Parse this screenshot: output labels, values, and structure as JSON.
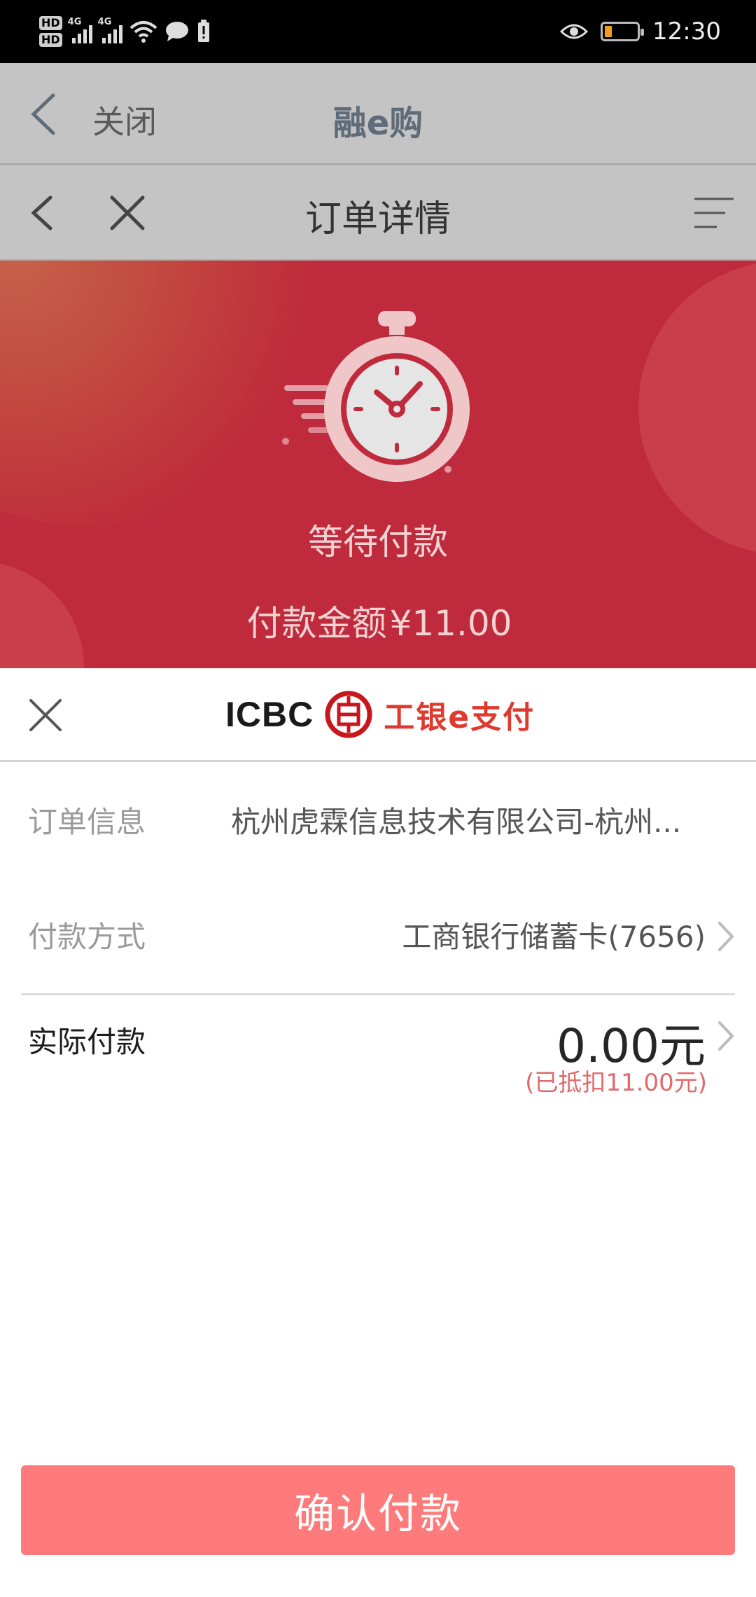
{
  "statusbar": {
    "hd1": "HD",
    "hd2": "HD",
    "net1": "4G",
    "net2": "4G",
    "time": "12:30",
    "battery_level": 0.2,
    "icons": [
      "hd-icon",
      "signal-icon",
      "wifi-icon",
      "message-icon",
      "battery-alert-icon",
      "eye-icon",
      "battery-icon"
    ]
  },
  "nav1": {
    "close_label": "关闭",
    "title": "融e购"
  },
  "nav2": {
    "title": "订单详情"
  },
  "hero": {
    "status": "等待付款",
    "amount_label": "付款金额",
    "amount_value": "¥11.00"
  },
  "payment_sheet": {
    "brand_text": "ICBC",
    "brand_service": "工银e支付",
    "rows": {
      "order_info": {
        "label": "订单信息",
        "value": "杭州虎霖信息技术有限公司-杭州..."
      },
      "pay_method": {
        "label": "付款方式",
        "value": "工商银行储蓄卡(7656)"
      },
      "actual": {
        "label": "实际付款",
        "value": "0.00元",
        "deduction": "(已抵扣11.00元)"
      }
    },
    "confirm_label": "确认付款"
  },
  "colors": {
    "hero_red": "#bf2a3c",
    "nav_gray": "#c4c4c4",
    "confirm_pink": "#ff7b7b",
    "deduction_red": "#e06b6b",
    "brand_red": "#e0392e"
  }
}
